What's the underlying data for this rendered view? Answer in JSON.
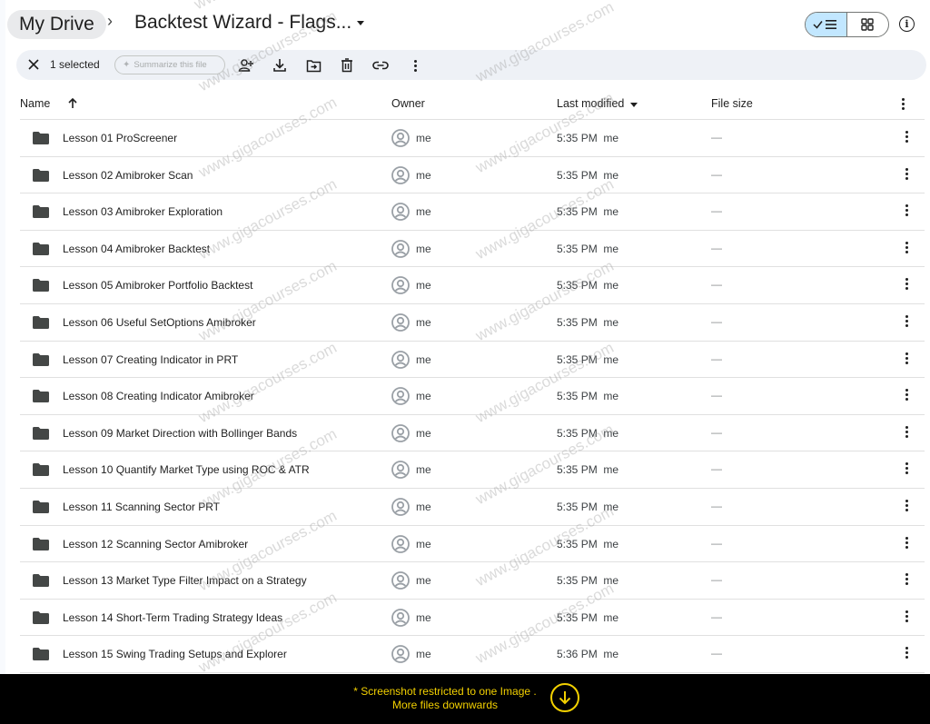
{
  "breadcrumb": {
    "root": "My Drive",
    "separator": "›",
    "current": "Backtest Wizard - Flags..."
  },
  "view_toggle": {
    "list_icon": "check-list-icon",
    "grid_icon": "grid-icon",
    "active": "list"
  },
  "info_icon": "info-icon",
  "action_bar": {
    "selected_label": "1 selected",
    "summarize_label": "Summarize this file",
    "actions": [
      {
        "icon": "share-person-add-icon",
        "label": "Share"
      },
      {
        "icon": "download-icon",
        "label": "Download"
      },
      {
        "icon": "move-folder-icon",
        "label": "Move"
      },
      {
        "icon": "trash-icon",
        "label": "Move to trash"
      },
      {
        "icon": "link-icon",
        "label": "Copy link"
      },
      {
        "icon": "more-vert-icon",
        "label": "More actions"
      }
    ]
  },
  "table": {
    "headers": {
      "name": "Name",
      "owner": "Owner",
      "last_modified": "Last modified",
      "file_size": "File size"
    },
    "sort": {
      "column": "name",
      "direction": "ascending"
    },
    "rows": [
      {
        "name": "Lesson 01 ProScreener",
        "owner": "me",
        "modified": "5:35 PM  me",
        "size": "—"
      },
      {
        "name": "Lesson 02 Amibroker Scan",
        "owner": "me",
        "modified": "5:35 PM  me",
        "size": "—"
      },
      {
        "name": "Lesson 03 Amibroker Exploration",
        "owner": "me",
        "modified": "5:35 PM  me",
        "size": "—"
      },
      {
        "name": "Lesson 04 Amibroker Backtest",
        "owner": "me",
        "modified": "5:35 PM  me",
        "size": "—"
      },
      {
        "name": "Lesson 05 Amibroker Portfolio Backtest",
        "owner": "me",
        "modified": "5:35 PM  me",
        "size": "—"
      },
      {
        "name": "Lesson 06 Useful SetOptions Amibroker",
        "owner": "me",
        "modified": "5:35 PM  me",
        "size": "—"
      },
      {
        "name": "Lesson 07 Creating Indicator in PRT",
        "owner": "me",
        "modified": "5:35 PM  me",
        "size": "—"
      },
      {
        "name": "Lesson 08 Creating Indicator Amibroker",
        "owner": "me",
        "modified": "5:35 PM  me",
        "size": "—"
      },
      {
        "name": "Lesson 09 Market Direction with Bollinger Bands",
        "owner": "me",
        "modified": "5:35 PM  me",
        "size": "—"
      },
      {
        "name": "Lesson 10 Quantify Market Type using ROC & ATR",
        "owner": "me",
        "modified": "5:35 PM  me",
        "size": "—"
      },
      {
        "name": "Lesson 11 Scanning Sector PRT",
        "owner": "me",
        "modified": "5:35 PM  me",
        "size": "—"
      },
      {
        "name": "Lesson 12 Scanning Sector Amibroker",
        "owner": "me",
        "modified": "5:35 PM  me",
        "size": "—"
      },
      {
        "name": "Lesson 13 Market Type Filter Impact on a Strategy",
        "owner": "me",
        "modified": "5:35 PM  me",
        "size": "—"
      },
      {
        "name": "Lesson 14 Short-Term Trading Strategy Ideas",
        "owner": "me",
        "modified": "5:35 PM  me",
        "size": "—"
      },
      {
        "name": "Lesson 15 Swing Trading Setups and Explorer",
        "owner": "me",
        "modified": "5:36 PM  me",
        "size": "—"
      }
    ]
  },
  "banner": {
    "line1": "* Screenshot restricted to one Image .",
    "line2": "More files downwards",
    "icon": "arrow-down-circle-icon",
    "color": "#f2d000"
  },
  "watermark": "www.gigacourses.com",
  "colors": {
    "toggle_active": "#c2e7ff",
    "action_bar_bg": "#eef1f6",
    "folder": "#444746"
  }
}
